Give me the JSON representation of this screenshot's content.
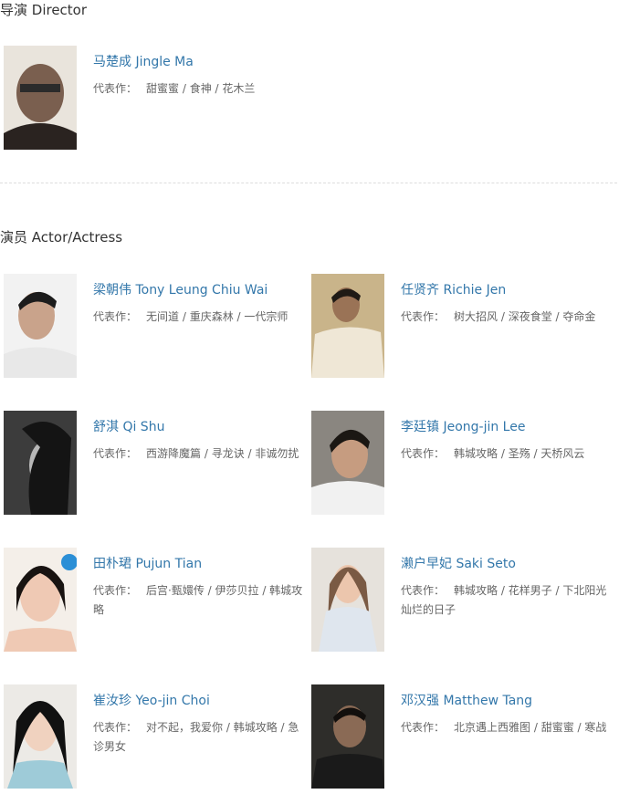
{
  "director_section": {
    "title": "导演 Director",
    "people": [
      {
        "name": "马楚成 Jingle Ma",
        "works_label": "代表作：",
        "works": "甜蜜蜜 / 食神 / 花木兰"
      }
    ]
  },
  "actor_section": {
    "title": "演员 Actor/Actress",
    "people": [
      {
        "name": "梁朝伟 Tony Leung Chiu Wai",
        "works_label": "代表作：",
        "works": "无间道 / 重庆森林 / 一代宗师"
      },
      {
        "name": "任贤齐 Richie Jen",
        "works_label": "代表作：",
        "works": "树大招风 / 深夜食堂 / 夺命金"
      },
      {
        "name": "舒淇 Qi Shu",
        "works_label": "代表作：",
        "works": "西游降魔篇 / 寻龙诀 / 非诚勿扰"
      },
      {
        "name": "李廷镇 Jeong-jin Lee",
        "works_label": "代表作：",
        "works": "韩城攻略 / 圣殇 / 天桥风云"
      },
      {
        "name": "田朴珺 Pujun Tian",
        "works_label": "代表作：",
        "works": "后宫·甄嬛传 / 伊莎贝拉 / 韩城攻略"
      },
      {
        "name": "濑户早妃 Saki Seto",
        "works_label": "代表作：",
        "works": "韩城攻略 / 花样男子 / 下北阳光灿烂的日子"
      },
      {
        "name": "崔汝珍 Yeo-jin Choi",
        "works_label": "代表作：",
        "works": "对不起，我爱你 / 韩城攻略 / 急诊男女"
      },
      {
        "name": "邓汉强 Matthew Tang",
        "works_label": "代表作：",
        "works": "北京遇上西雅图 / 甜蜜蜜 / 寒战"
      }
    ]
  },
  "colors": {
    "link": "#3377aa",
    "text": "#333333",
    "muted": "#666666",
    "divider": "#dddddd"
  }
}
